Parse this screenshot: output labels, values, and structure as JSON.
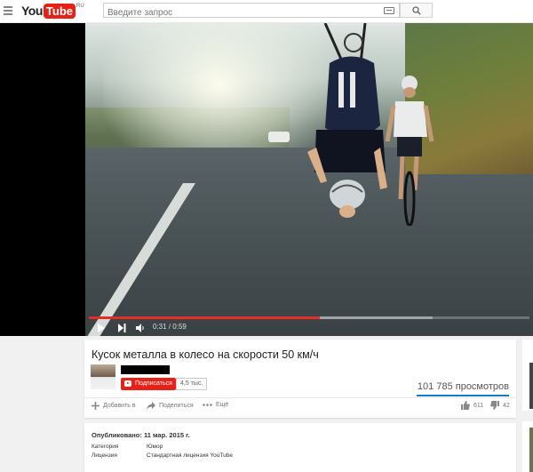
{
  "header": {
    "logo_you": "You",
    "logo_tube": "Tube",
    "logo_region": "RU",
    "search_placeholder": "Введите запрос"
  },
  "player": {
    "time_current": "0:31",
    "time_separator": "/",
    "time_total": "0:59",
    "progress_played_fraction": 0.525,
    "progress_buffered_fraction": 0.78
  },
  "video": {
    "title": "Кусок металла в колесо на скорости 50 км/ч",
    "subscribe_label": "Подписаться",
    "subscriber_count": "4,5 тыс.",
    "views": "101 785 просмотров",
    "actions": {
      "add_to": "Добавить в",
      "share": "Поделиться",
      "more": "Ещё"
    },
    "likes": "611",
    "dislikes": "42"
  },
  "details": {
    "published": "Опубликовано: 11 мар. 2015 г.",
    "category_label": "Категория",
    "category_value": "Юмор",
    "license_label": "Лицензия",
    "license_value": "Стандартная лицензия YouTube"
  },
  "colors": {
    "brand_red": "#e62117",
    "progress_red": "#e52d27",
    "views_underline": "#167ac6"
  },
  "icons": [
    "menu-icon",
    "keyboard-icon",
    "search-icon",
    "play-icon",
    "next-icon",
    "volume-icon",
    "add-icon",
    "share-icon",
    "more-icon",
    "like-icon",
    "dislike-icon"
  ]
}
